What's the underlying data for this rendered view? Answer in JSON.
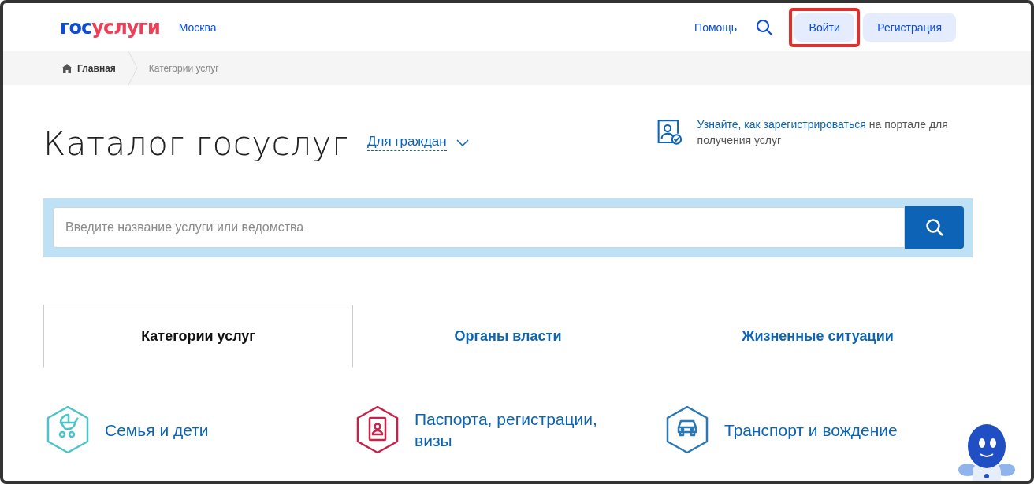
{
  "header": {
    "logo_prefix": "гос",
    "logo_suffix": "услуги",
    "city": "Москва",
    "help": "Помощь",
    "login": {
      "label": "Войти",
      "highlighted": true
    },
    "register": "Регистрация"
  },
  "breadcrumbs": [
    {
      "label": "Главная",
      "kind": "home"
    },
    {
      "label": "Категории услуг",
      "kind": "current"
    }
  ],
  "title": "Каталог госуслуг",
  "audience": "Для граждан",
  "register_hint": {
    "link": "Узнайте, как зарегистрироваться",
    "rest": "на портале для получения услуг"
  },
  "search": {
    "placeholder": "Введите название услуги или ведомства"
  },
  "tabs": [
    {
      "label": "Категории услуг",
      "selected": true
    },
    {
      "label": "Органы власти",
      "selected": false
    },
    {
      "label": "Жизненные ситуации",
      "selected": false
    }
  ],
  "categories": [
    {
      "label": "Семья и дети",
      "kind": "stroller",
      "color": "#4cc3c7"
    },
    {
      "label": "Паспорта, регистрации, визы",
      "kind": "passport",
      "color": "#c8224a"
    },
    {
      "label": "Транспорт и вождение",
      "kind": "car",
      "color": "#2a78b4"
    }
  ]
}
